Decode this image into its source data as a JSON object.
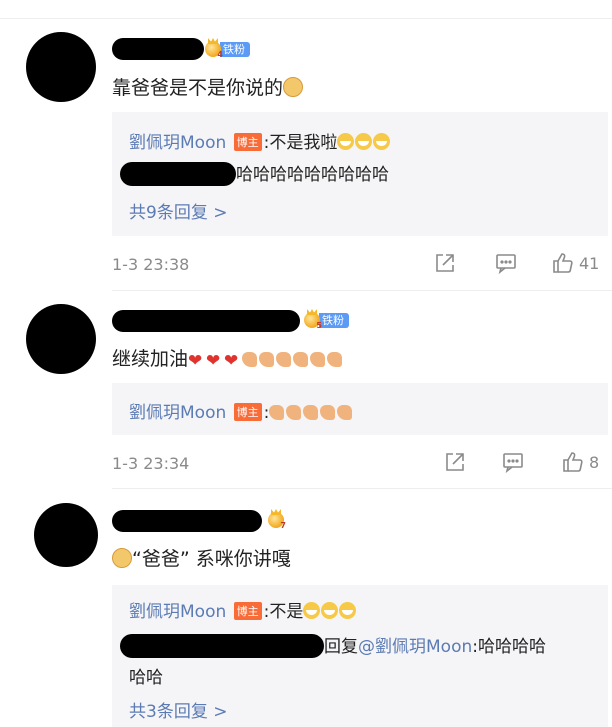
{
  "comments": [
    {
      "fan_badge": "铁粉",
      "text": "靠爸爸是不是你说的",
      "replies": [
        {
          "name": "劉佩玥Moon",
          "tag": "博主",
          "text": ":不是我啦"
        },
        {
          "text": "哈哈哈哈哈哈哈哈哈"
        }
      ],
      "more": "共9条回复 >",
      "time": "1-3 23:38",
      "likes": "41"
    },
    {
      "fan_badge": "铁粉",
      "text": "继续加油",
      "replies": [
        {
          "name": "劉佩玥Moon",
          "tag": "博主",
          "text": ":"
        }
      ],
      "time": "1-3 23:34",
      "likes": "8"
    },
    {
      "text": "“爸爸” 系咪你讲嘎",
      "replies": [
        {
          "name": "劉佩玥Moon",
          "tag": "博主",
          "text": ":不是"
        },
        {
          "prefix": "回复",
          "mention": "@劉佩玥Moon",
          "text": ":哈哈哈哈",
          "text2": "哈哈"
        }
      ],
      "more": "共3条回复 >"
    }
  ],
  "icons": [
    "share-icon",
    "comment-icon",
    "like-icon"
  ]
}
